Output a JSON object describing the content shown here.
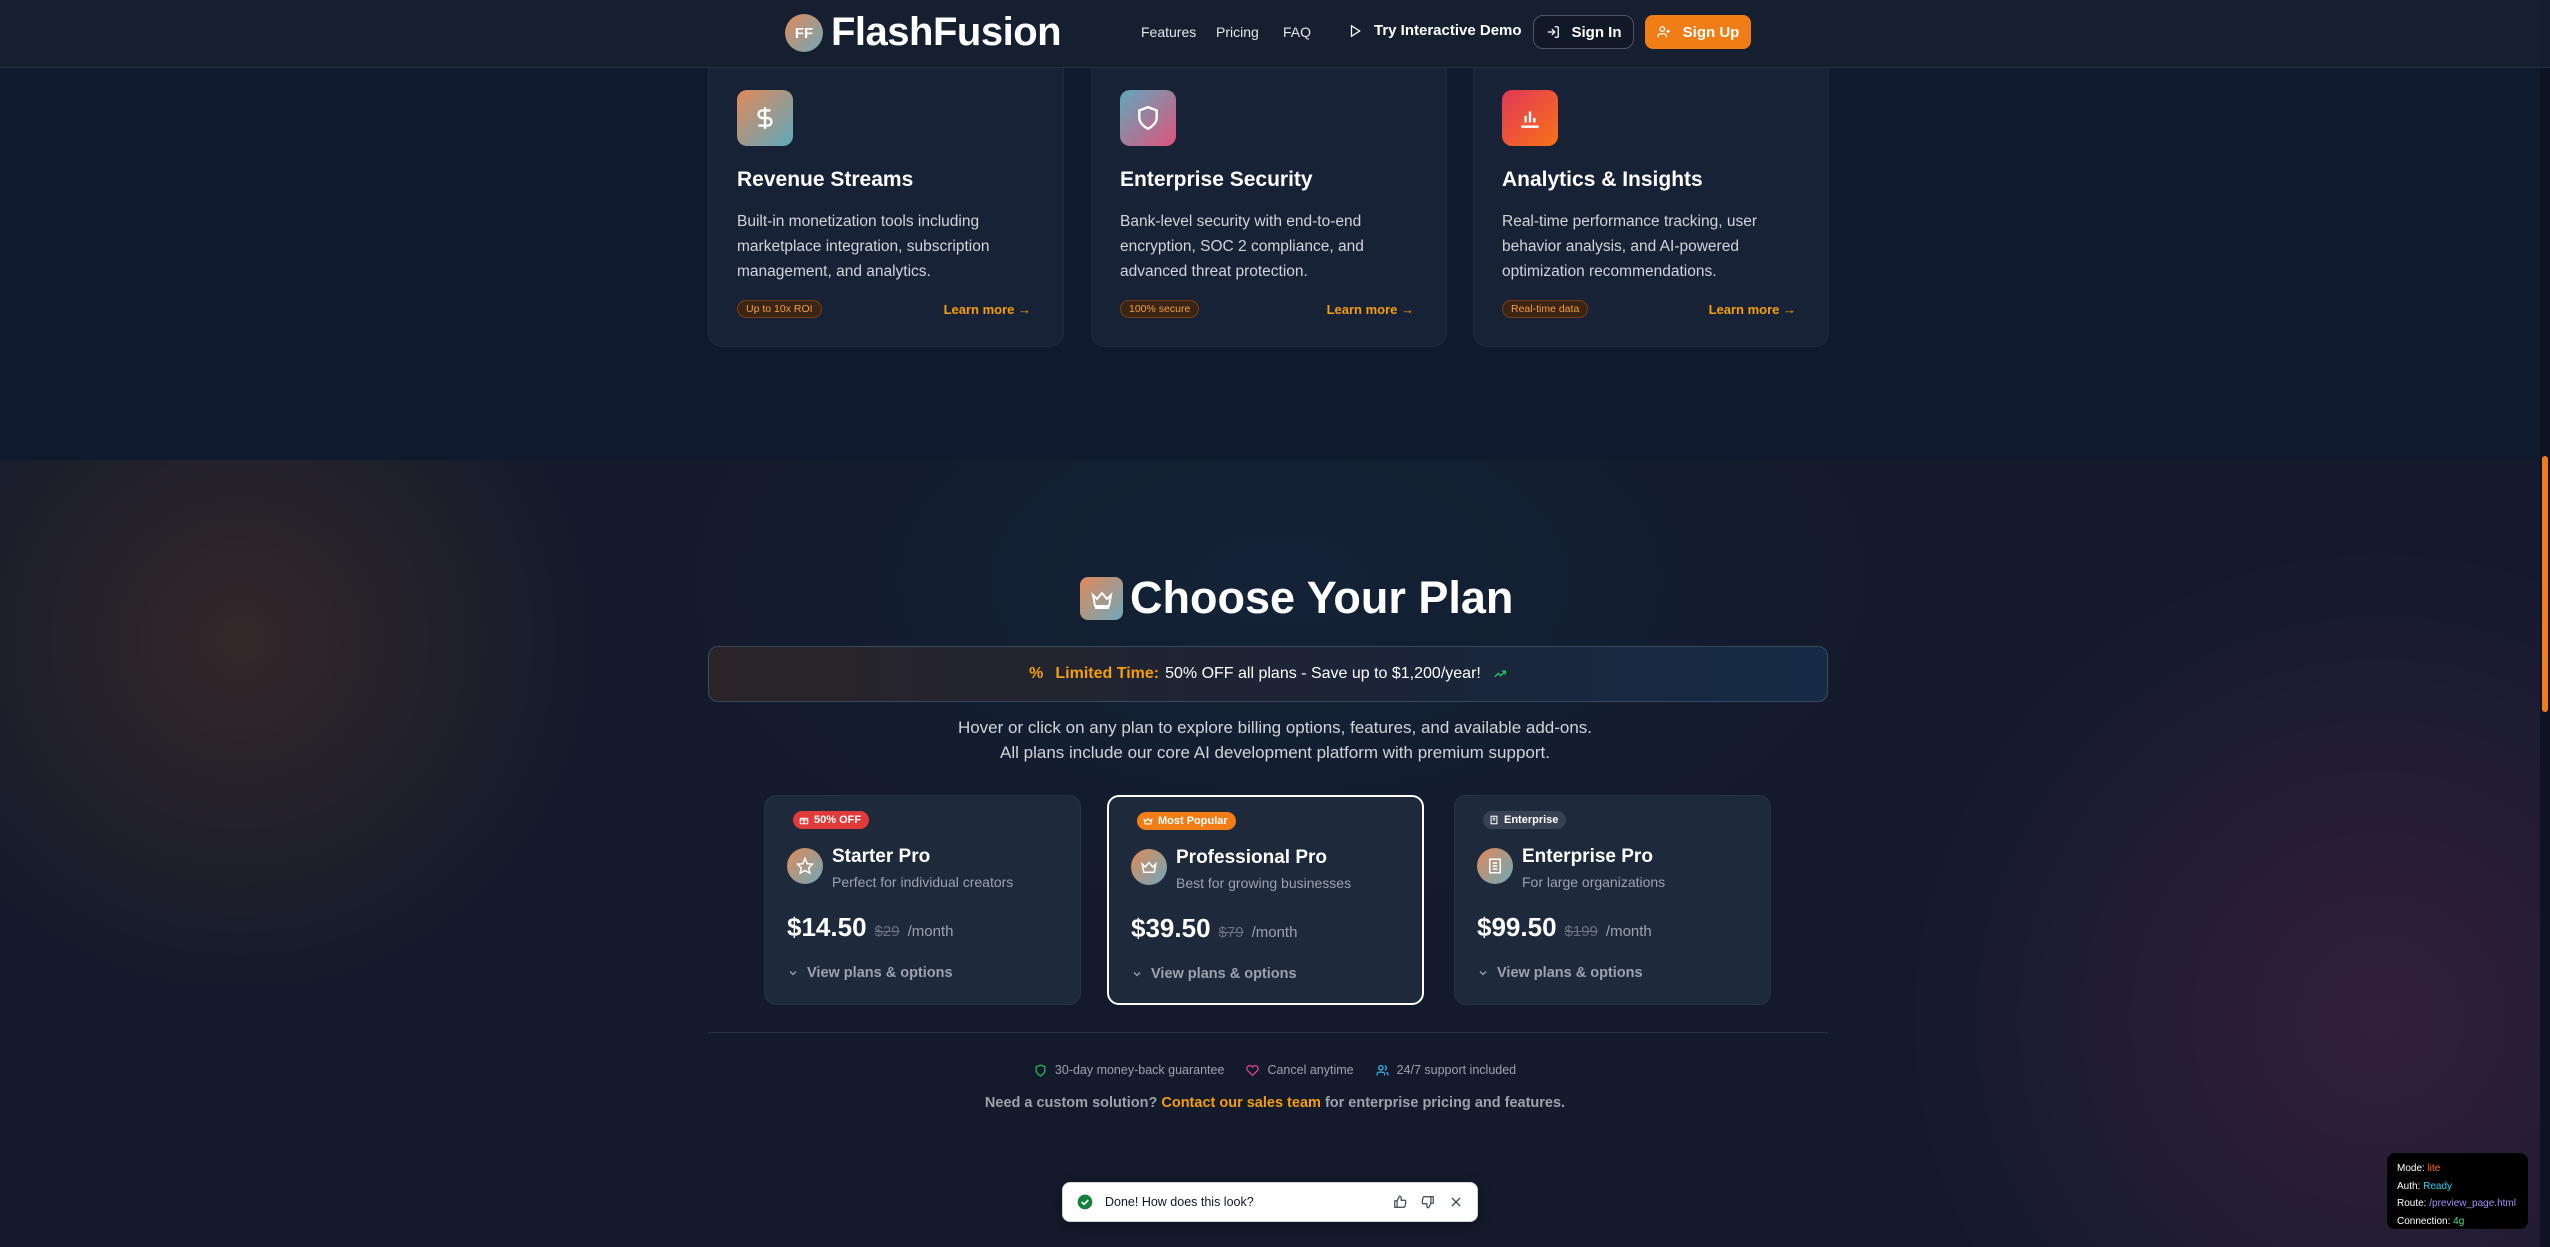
{
  "navbar": {
    "logo_initials": "FF",
    "brand": "FlashFusion",
    "links": [
      "Features",
      "Pricing",
      "FAQ"
    ],
    "demo": "Try Interactive Demo",
    "signin": "Sign In",
    "signup": "Sign Up"
  },
  "features": [
    {
      "icon": "dollar-icon",
      "title": "Revenue Streams",
      "description": "Built-in monetization tools including marketplace integration, subscription management, and analytics.",
      "badge": "Up to 10x ROI",
      "learn": "Learn more"
    },
    {
      "icon": "shield-icon",
      "title": "Enterprise Security",
      "description": "Bank-level security with end-to-end encryption, SOC 2 compliance, and advanced threat protection.",
      "badge": "100% secure",
      "learn": "Learn more"
    },
    {
      "icon": "bar-chart-icon",
      "title": "Analytics & Insights",
      "description": "Real-time performance tracking, user behavior analysis, and AI-powered optimization recommendations.",
      "badge": "Real-time data",
      "learn": "Learn more"
    }
  ],
  "pricing": {
    "heading": "Choose Your Plan",
    "promo_strong": "Limited Time:",
    "promo_text": "50% OFF all plans - Save up to $1,200/year!",
    "intro_line1": "Hover or click on any plan to explore billing options, features, and available add-ons.",
    "intro_line2": "All plans include our core AI development platform with premium support.",
    "plans": [
      {
        "tag": "50% OFF",
        "name": "Starter Pro",
        "subtitle": "Perfect for individual creators",
        "price": "$14.50",
        "old_price": "$29",
        "period": "/month",
        "options": "View plans & options"
      },
      {
        "tag": "Most Popular",
        "name": "Professional Pro",
        "subtitle": "Best for growing businesses",
        "price": "$39.50",
        "old_price": "$79",
        "period": "/month",
        "options": "View plans & options"
      },
      {
        "tag": "Enterprise",
        "name": "Enterprise Pro",
        "subtitle": "For large organizations",
        "price": "$99.50",
        "old_price": "$199",
        "period": "/month",
        "options": "View plans & options"
      }
    ],
    "assurances": [
      "30-day money-back guarantee",
      "Cancel anytime",
      "24/7 support included"
    ],
    "custom_prefix": "Need a custom solution?",
    "custom_link": "Contact our sales team",
    "custom_suffix": "for enterprise pricing and features."
  },
  "toast": {
    "text": "Done! How does this look?"
  },
  "debug": {
    "mode_label": "Mode:",
    "mode": "lite",
    "auth_label": "Auth:",
    "auth": "Ready",
    "route_label": "Route:",
    "route": "/preview_page.html",
    "connection_label": "Connection:",
    "connection": "4g"
  },
  "colors": {
    "accent": "#f07d16",
    "background": "#0f1a2e",
    "card": "#1e293b"
  }
}
